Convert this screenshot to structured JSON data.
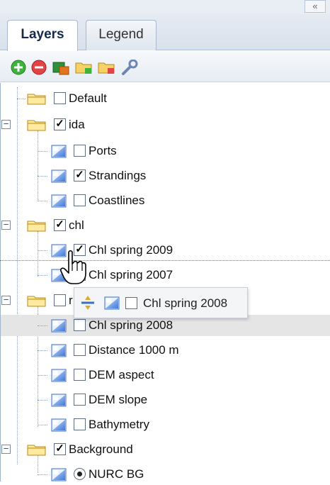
{
  "panel": {
    "collapse_label": "«"
  },
  "tabs": [
    {
      "label": "Layers",
      "active": true
    },
    {
      "label": "Legend",
      "active": false
    }
  ],
  "toolbar": {
    "buttons": [
      "add-icon",
      "remove-icon",
      "add-layer-icon",
      "add-folder-icon",
      "remove-folder-icon",
      "properties-icon"
    ]
  },
  "tree": {
    "default": {
      "label": "Default",
      "checked": false
    },
    "ida": {
      "label": "ida",
      "checked": true,
      "children": [
        {
          "label": "Ports",
          "checked": false
        },
        {
          "label": "Strandings",
          "checked": true
        },
        {
          "label": "Coastlines",
          "checked": false
        }
      ]
    },
    "chl": {
      "label": "chl",
      "checked": true,
      "children": [
        {
          "label": "Chl spring 2009",
          "checked": true
        },
        {
          "label": "Chl spring 2007",
          "checked": true
        }
      ]
    },
    "r_folder": {
      "label": "r",
      "checked": false,
      "children": [
        {
          "label": "Chl spring 2008",
          "checked": false,
          "selected": true
        },
        {
          "label": "Distance 1000 m",
          "checked": false
        },
        {
          "label": "DEM aspect",
          "checked": false
        },
        {
          "label": "DEM slope",
          "checked": false
        },
        {
          "label": "Bathymetry",
          "checked": false
        }
      ]
    },
    "background": {
      "label": "Background",
      "checked": true,
      "children": [
        {
          "label": "NURC BG",
          "selected": true
        }
      ]
    }
  },
  "drag": {
    "label": "Chl spring 2008",
    "icon": "drop-insert-icon"
  },
  "colors": {
    "accent": "#4f79c6",
    "selection": "#e5e5e5"
  }
}
